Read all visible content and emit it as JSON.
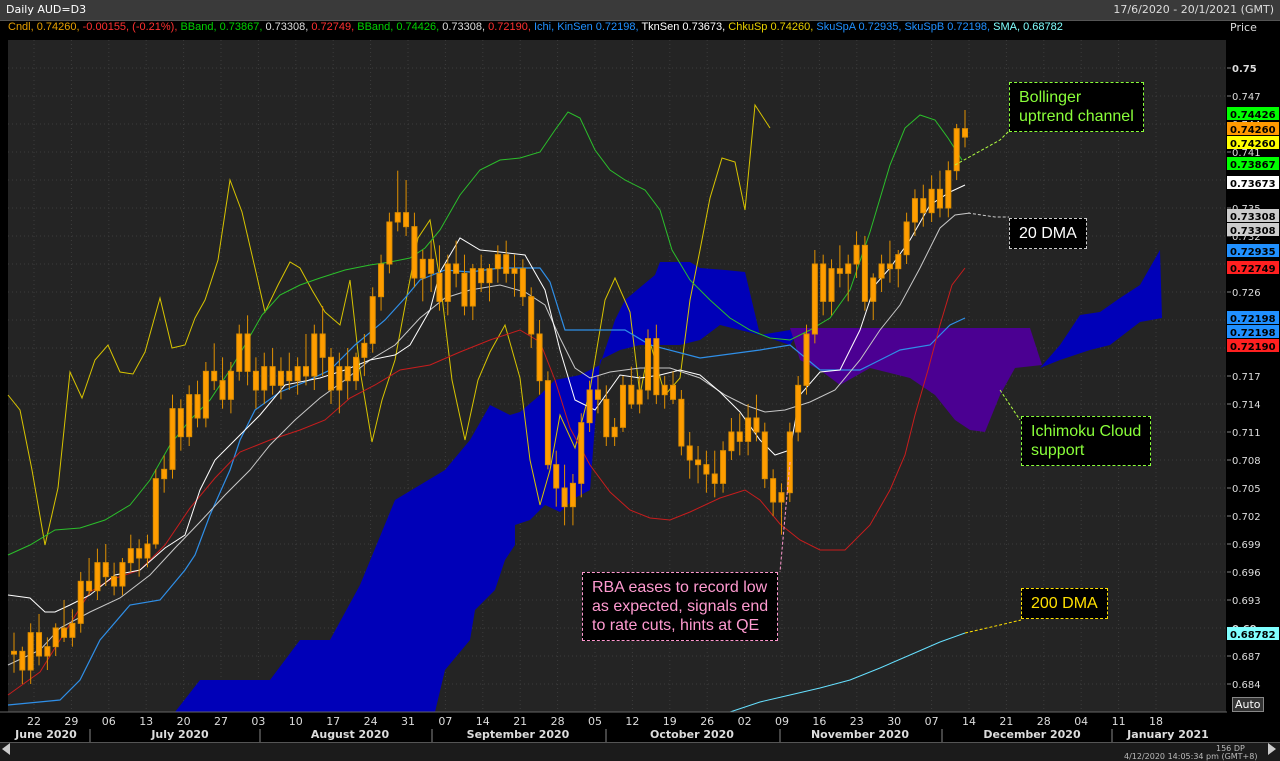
{
  "header": {
    "title": "Daily AUD=D3",
    "date_range": "17/6/2020 - 20/1/2021 (GMT)",
    "price_label": "Price"
  },
  "legend": [
    {
      "text": "Cndl, ",
      "color": "#e8a000"
    },
    {
      "text": "0.74260, ",
      "color": "#e8a000"
    },
    {
      "text": "-0.00155, (-0.21%), ",
      "color": "#ff3030"
    },
    {
      "text": "BBand, ",
      "color": "#00d000"
    },
    {
      "text": "0.73867, ",
      "color": "#00d000"
    },
    {
      "text": "0.73308, ",
      "color": "#dddddd"
    },
    {
      "text": "0.72749, ",
      "color": "#ff3030"
    },
    {
      "text": "BBand, ",
      "color": "#00d000"
    },
    {
      "text": "0.74426, ",
      "color": "#00d000"
    },
    {
      "text": "0.73308, ",
      "color": "#dddddd"
    },
    {
      "text": "0.72190, ",
      "color": "#ff3030"
    },
    {
      "text": "Ichi, ",
      "color": "#2090ff"
    },
    {
      "text": "KinSen 0.72198, ",
      "color": "#2090ff"
    },
    {
      "text": "TknSen 0.73673, ",
      "color": "#ffffff"
    },
    {
      "text": "ChkuSp 0.74260, ",
      "color": "#e8d000"
    },
    {
      "text": "SkuSpA 0.72935, ",
      "color": "#2090ff"
    },
    {
      "text": "SkuSpB 0.72198, ",
      "color": "#2090ff"
    },
    {
      "text": "SMA, 0.68782",
      "color": "#80ffff"
    }
  ],
  "annotations": {
    "bollinger": "Bollinger\nuptrend channel",
    "dma20": "20 DMA",
    "ichimoku": "Ichimoku Cloud\nsupport",
    "rba": "RBA eases to record low\nas expected, signals end\nto rate cuts, hints at QE",
    "dma200": "200 DMA"
  },
  "price_badges": [
    {
      "value": "0.74426",
      "color": "#00ff00",
      "text_color": "#000"
    },
    {
      "value": "0.74260",
      "color": "#ff9900",
      "text_color": "#000"
    },
    {
      "value": "0.74260",
      "color": "#ffff00",
      "text_color": "#000"
    },
    {
      "value": "0.73867",
      "color": "#00ff00",
      "text_color": "#000"
    },
    {
      "value": "0.73673",
      "color": "#ffffff",
      "text_color": "#000"
    },
    {
      "value": "0.73308",
      "color": "#cccccc",
      "text_color": "#000"
    },
    {
      "value": "0.73308",
      "color": "#cccccc",
      "text_color": "#000"
    },
    {
      "value": "0.72935",
      "color": "#2090ff",
      "text_color": "#000"
    },
    {
      "value": "0.72749",
      "color": "#ff2020",
      "text_color": "#000"
    },
    {
      "value": "0.72198",
      "color": "#2090ff",
      "text_color": "#000"
    },
    {
      "value": "0.72198",
      "color": "#2090ff",
      "text_color": "#000"
    },
    {
      "value": "0.72190",
      "color": "#ff2020",
      "text_color": "#000"
    },
    {
      "value": "0.68782",
      "color": "#80ffff",
      "text_color": "#000"
    }
  ],
  "footer": {
    "auto": "Auto",
    "zoom": "156 DP",
    "timestamp": "4/12/2020 14:05:34 pm (GMT+8)"
  },
  "chart_data": {
    "type": "line",
    "title": "Daily AUD=D3",
    "ylabel": "Price",
    "ylim": [
      0.681,
      0.753
    ],
    "y_ticks": [
      "0.75",
      "0.747",
      "0.744",
      "0.741",
      "0.738",
      "0.735",
      "0.732",
      "0.729",
      "0.726",
      "0.723",
      "0.72",
      "0.717",
      "0.714",
      "0.711",
      "0.708",
      "0.705",
      "0.702",
      "0.699",
      "0.696",
      "0.693",
      "0.69",
      "0.687",
      "0.684"
    ],
    "x_day_ticks": [
      "22",
      "29",
      "06",
      "13",
      "20",
      "27",
      "03",
      "10",
      "17",
      "24",
      "31",
      "07",
      "14",
      "21",
      "28",
      "05",
      "12",
      "19",
      "26",
      "02",
      "09",
      "16",
      "23",
      "30",
      "07",
      "14",
      "21",
      "28",
      "04",
      "11",
      "18"
    ],
    "x_month_labels": [
      "June 2020",
      "July 2020",
      "August 2020",
      "September 2020",
      "October 2020",
      "November 2020",
      "December 2020",
      "January 2021"
    ],
    "candles": [
      [
        0.6872,
        0.6895,
        0.6852,
        0.6875
      ],
      [
        0.6875,
        0.688,
        0.684,
        0.6855
      ],
      [
        0.6855,
        0.6905,
        0.684,
        0.6895
      ],
      [
        0.6895,
        0.6915,
        0.686,
        0.687
      ],
      [
        0.687,
        0.689,
        0.6855,
        0.688
      ],
      [
        0.688,
        0.6905,
        0.687,
        0.69
      ],
      [
        0.69,
        0.693,
        0.6885,
        0.689
      ],
      [
        0.689,
        0.692,
        0.688,
        0.6905
      ],
      [
        0.6905,
        0.696,
        0.6895,
        0.695
      ],
      [
        0.695,
        0.6975,
        0.6935,
        0.694
      ],
      [
        0.694,
        0.6985,
        0.693,
        0.697
      ],
      [
        0.697,
        0.699,
        0.6945,
        0.6955
      ],
      [
        0.6955,
        0.697,
        0.6935,
        0.6945
      ],
      [
        0.6945,
        0.6975,
        0.6935,
        0.697
      ],
      [
        0.697,
        0.7,
        0.696,
        0.6985
      ],
      [
        0.6985,
        0.6995,
        0.6955,
        0.6975
      ],
      [
        0.6975,
        0.7,
        0.6965,
        0.699
      ],
      [
        0.699,
        0.707,
        0.6985,
        0.706
      ],
      [
        0.706,
        0.7085,
        0.7045,
        0.707
      ],
      [
        0.707,
        0.715,
        0.706,
        0.7135
      ],
      [
        0.7135,
        0.7145,
        0.709,
        0.7105
      ],
      [
        0.7105,
        0.716,
        0.7095,
        0.715
      ],
      [
        0.715,
        0.7165,
        0.7115,
        0.7125
      ],
      [
        0.7125,
        0.7185,
        0.7115,
        0.7175
      ],
      [
        0.7175,
        0.7205,
        0.7155,
        0.7165
      ],
      [
        0.7165,
        0.719,
        0.7135,
        0.7145
      ],
      [
        0.7145,
        0.7185,
        0.713,
        0.7175
      ],
      [
        0.7175,
        0.7225,
        0.7165,
        0.7215
      ],
      [
        0.7215,
        0.7235,
        0.716,
        0.7175
      ],
      [
        0.7175,
        0.719,
        0.7135,
        0.7155
      ],
      [
        0.7155,
        0.7195,
        0.714,
        0.718
      ],
      [
        0.718,
        0.72,
        0.715,
        0.716
      ],
      [
        0.716,
        0.719,
        0.7145,
        0.7175
      ],
      [
        0.7175,
        0.7195,
        0.7155,
        0.7165
      ],
      [
        0.7165,
        0.719,
        0.715,
        0.718
      ],
      [
        0.718,
        0.7215,
        0.716,
        0.717
      ],
      [
        0.717,
        0.7225,
        0.7155,
        0.7215
      ],
      [
        0.7215,
        0.7245,
        0.717,
        0.719
      ],
      [
        0.719,
        0.72,
        0.714,
        0.7155
      ],
      [
        0.7155,
        0.7195,
        0.713,
        0.718
      ],
      [
        0.718,
        0.72,
        0.7145,
        0.7165
      ],
      [
        0.7165,
        0.7195,
        0.7155,
        0.719
      ],
      [
        0.719,
        0.7215,
        0.717,
        0.7205
      ],
      [
        0.7205,
        0.7265,
        0.7195,
        0.7255
      ],
      [
        0.7255,
        0.73,
        0.724,
        0.729
      ],
      [
        0.729,
        0.7345,
        0.728,
        0.7335
      ],
      [
        0.7335,
        0.739,
        0.7325,
        0.7345
      ],
      [
        0.7345,
        0.738,
        0.732,
        0.733
      ],
      [
        0.733,
        0.7345,
        0.7265,
        0.7275
      ],
      [
        0.7275,
        0.7305,
        0.725,
        0.7295
      ],
      [
        0.7295,
        0.7315,
        0.726,
        0.728
      ],
      [
        0.728,
        0.731,
        0.724,
        0.725
      ],
      [
        0.725,
        0.73,
        0.7235,
        0.729
      ],
      [
        0.729,
        0.7315,
        0.7265,
        0.728
      ],
      [
        0.728,
        0.73,
        0.7235,
        0.7245
      ],
      [
        0.7245,
        0.729,
        0.723,
        0.7285
      ],
      [
        0.7285,
        0.73,
        0.726,
        0.727
      ],
      [
        0.727,
        0.729,
        0.725,
        0.7285
      ],
      [
        0.7285,
        0.731,
        0.727,
        0.73
      ],
      [
        0.73,
        0.7315,
        0.727,
        0.728
      ],
      [
        0.728,
        0.73,
        0.7255,
        0.7285
      ],
      [
        0.7285,
        0.7295,
        0.7245,
        0.7255
      ],
      [
        0.7255,
        0.7265,
        0.72,
        0.7215
      ],
      [
        0.7215,
        0.723,
        0.715,
        0.7165
      ],
      [
        0.7165,
        0.7175,
        0.707,
        0.7075
      ],
      [
        0.7075,
        0.709,
        0.703,
        0.705
      ],
      [
        0.705,
        0.7075,
        0.701,
        0.703
      ],
      [
        0.703,
        0.7065,
        0.701,
        0.7055
      ],
      [
        0.7055,
        0.713,
        0.704,
        0.712
      ],
      [
        0.712,
        0.7165,
        0.711,
        0.7155
      ],
      [
        0.7155,
        0.717,
        0.713,
        0.7145
      ],
      [
        0.7145,
        0.716,
        0.7095,
        0.7105
      ],
      [
        0.7105,
        0.7125,
        0.7095,
        0.7115
      ],
      [
        0.7115,
        0.717,
        0.711,
        0.716
      ],
      [
        0.716,
        0.718,
        0.7135,
        0.714
      ],
      [
        0.714,
        0.717,
        0.713,
        0.7155
      ],
      [
        0.7155,
        0.722,
        0.7145,
        0.721
      ],
      [
        0.721,
        0.7225,
        0.714,
        0.715
      ],
      [
        0.715,
        0.717,
        0.7135,
        0.716
      ],
      [
        0.716,
        0.7175,
        0.714,
        0.7145
      ],
      [
        0.7145,
        0.7155,
        0.7085,
        0.7095
      ],
      [
        0.7095,
        0.711,
        0.706,
        0.708
      ],
      [
        0.708,
        0.7095,
        0.7055,
        0.7075
      ],
      [
        0.7075,
        0.709,
        0.7045,
        0.7065
      ],
      [
        0.7065,
        0.709,
        0.704,
        0.7055
      ],
      [
        0.7055,
        0.71,
        0.7045,
        0.709
      ],
      [
        0.709,
        0.7125,
        0.708,
        0.711
      ],
      [
        0.711,
        0.713,
        0.7085,
        0.71
      ],
      [
        0.71,
        0.714,
        0.7085,
        0.7125
      ],
      [
        0.7125,
        0.715,
        0.71,
        0.711
      ],
      [
        0.711,
        0.712,
        0.705,
        0.706
      ],
      [
        0.706,
        0.707,
        0.702,
        0.7035
      ],
      [
        0.7035,
        0.7055,
        0.7,
        0.7045
      ],
      [
        0.7045,
        0.712,
        0.7035,
        0.711
      ],
      [
        0.711,
        0.717,
        0.71,
        0.716
      ],
      [
        0.716,
        0.7225,
        0.715,
        0.7215
      ],
      [
        0.7215,
        0.7305,
        0.7205,
        0.729
      ],
      [
        0.729,
        0.73,
        0.7235,
        0.725
      ],
      [
        0.725,
        0.7295,
        0.7235,
        0.7285
      ],
      [
        0.7285,
        0.731,
        0.7265,
        0.728
      ],
      [
        0.728,
        0.73,
        0.725,
        0.729
      ],
      [
        0.729,
        0.7325,
        0.7275,
        0.731
      ],
      [
        0.731,
        0.732,
        0.724,
        0.725
      ],
      [
        0.725,
        0.728,
        0.723,
        0.7275
      ],
      [
        0.7275,
        0.73,
        0.726,
        0.729
      ],
      [
        0.729,
        0.7315,
        0.727,
        0.7285
      ],
      [
        0.7285,
        0.7305,
        0.7265,
        0.73
      ],
      [
        0.73,
        0.7345,
        0.729,
        0.7335
      ],
      [
        0.7335,
        0.737,
        0.732,
        0.736
      ],
      [
        0.736,
        0.7375,
        0.733,
        0.7345
      ],
      [
        0.7345,
        0.7385,
        0.7335,
        0.737
      ],
      [
        0.737,
        0.739,
        0.734,
        0.735
      ],
      [
        0.735,
        0.74,
        0.734,
        0.739
      ],
      [
        0.739,
        0.744,
        0.738,
        0.7435
      ],
      [
        0.7435,
        0.7455,
        0.7415,
        0.7426
      ]
    ],
    "series": [
      {
        "name": "BBand",
        "role": "upper",
        "color": "#2bd62b",
        "values": [
          0.696,
          0.6965,
          0.6975,
          0.6995,
          0.702,
          0.706,
          0.7105,
          0.715,
          0.7175,
          0.7205,
          0.723,
          0.7255,
          0.727,
          0.7285,
          0.7315,
          0.734,
          0.7365,
          0.738,
          0.7385,
          0.737,
          0.7355,
          0.7345,
          0.733,
          0.73,
          0.726,
          0.722,
          0.7205,
          0.72,
          0.7205,
          0.7225,
          0.7265,
          0.7305,
          0.7345,
          0.737,
          0.7395,
          0.742,
          0.744,
          0.7455,
          0.7435
        ]
      },
      {
        "name": "BBand",
        "role": "lower",
        "color": "#d21c1c",
        "values": [
          0.68,
          0.6815,
          0.6835,
          0.686,
          0.6895,
          0.6935,
          0.6975,
          0.701,
          0.7035,
          0.706,
          0.7085,
          0.71,
          0.7115,
          0.7135,
          0.7165,
          0.719,
          0.72,
          0.7185,
          0.715,
          0.711,
          0.708,
          0.705,
          0.703,
          0.7015,
          0.7015,
          0.7025,
          0.704,
          0.7055,
          0.706,
          0.706,
          0.704,
          0.702,
          0.7005,
          0.6985,
          0.6975,
          0.698,
          0.702,
          0.71,
          0.719,
          0.7275
        ]
      },
      {
        "name": "SMA",
        "color": "#66e0ff",
        "values": [
          0.6765,
          0.6775,
          0.679,
          0.6805,
          0.682,
          0.6835,
          0.685,
          0.6862,
          0.6875,
          0.6882
        ]
      }
    ]
  }
}
